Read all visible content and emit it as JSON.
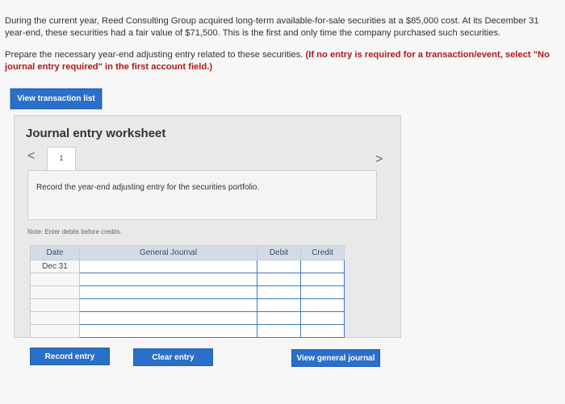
{
  "problem": {
    "line1": "During the current year, Reed Consulting Group acquired long-term available-for-sale securities at a $85,000 cost. At its December 31",
    "line2": "year-end, these securities had a fair value of $71,500. This is the first and only time the company purchased such securities."
  },
  "instructions": {
    "line1_plain": "Prepare the necessary year-end adjusting entry related to these securities. ",
    "line1_red": "(If no entry is required for a transaction/event, select \"No",
    "line2_red": "journal entry required\" in the first account field.)"
  },
  "buttons": {
    "view_transaction_list": "View transaction list",
    "record_entry": "Record entry",
    "clear_entry": "Clear entry",
    "view_general_journal": "View general journal"
  },
  "worksheet": {
    "title": "Journal entry worksheet",
    "nav_prev": "<",
    "nav_next": ">",
    "page_tab": "1",
    "task": "Record the year-end adjusting entry for the securities portfolio.",
    "note": "Note: Enter debits before credits."
  },
  "table": {
    "headers": {
      "date": "Date",
      "general_journal": "General Journal",
      "debit": "Debit",
      "credit": "Credit"
    },
    "rows": [
      {
        "date": "Dec 31"
      },
      {
        "date": ""
      },
      {
        "date": ""
      },
      {
        "date": ""
      },
      {
        "date": ""
      },
      {
        "date": ""
      }
    ]
  },
  "colors": {
    "button_blue": "#2a6fc9",
    "instruction_red": "#b01818",
    "header_bg": "#d3dbe6"
  }
}
